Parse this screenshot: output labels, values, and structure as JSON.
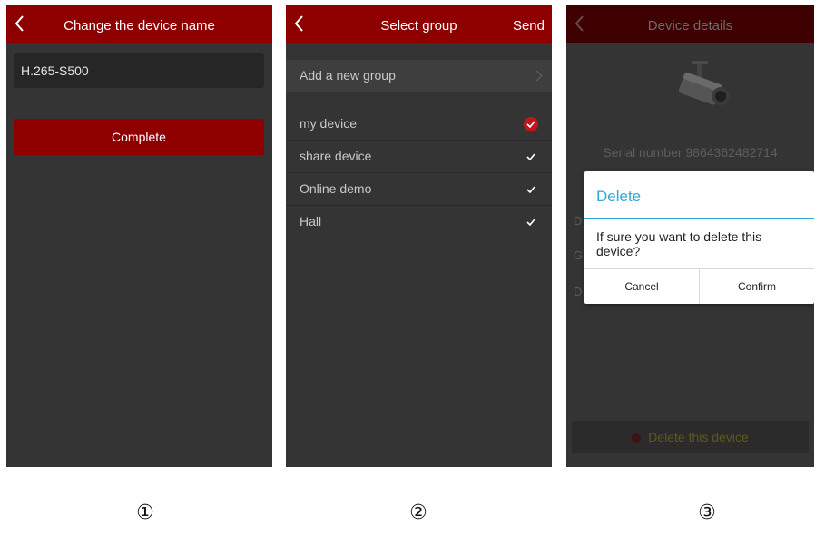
{
  "screen1": {
    "title": "Change the device name",
    "device_name_value": "H.265-S500",
    "complete_label": "Complete"
  },
  "screen2": {
    "title": "Select group",
    "send_label": "Send",
    "add_group_label": "Add a new group",
    "groups": [
      {
        "label": "my device",
        "selected": true
      },
      {
        "label": "share device",
        "selected": false
      },
      {
        "label": "Online demo",
        "selected": false
      },
      {
        "label": "Hall",
        "selected": false
      }
    ]
  },
  "screen3": {
    "title": "Device details",
    "serial_text": "Serial number 9864362482714",
    "partial_labels": [
      "D",
      "G",
      "D"
    ],
    "delete_device_label": "Delete this device",
    "dialog": {
      "title": "Delete",
      "message": "If sure you want to delete this device?",
      "cancel_label": "Cancel",
      "confirm_label": "Confirm"
    }
  },
  "step_labels": [
    "①",
    "②",
    "③"
  ],
  "colors": {
    "header_red": "#8e0000",
    "check_red": "#c0161c",
    "dialog_accent": "#30a8d8",
    "screen_bg": "#343434"
  }
}
